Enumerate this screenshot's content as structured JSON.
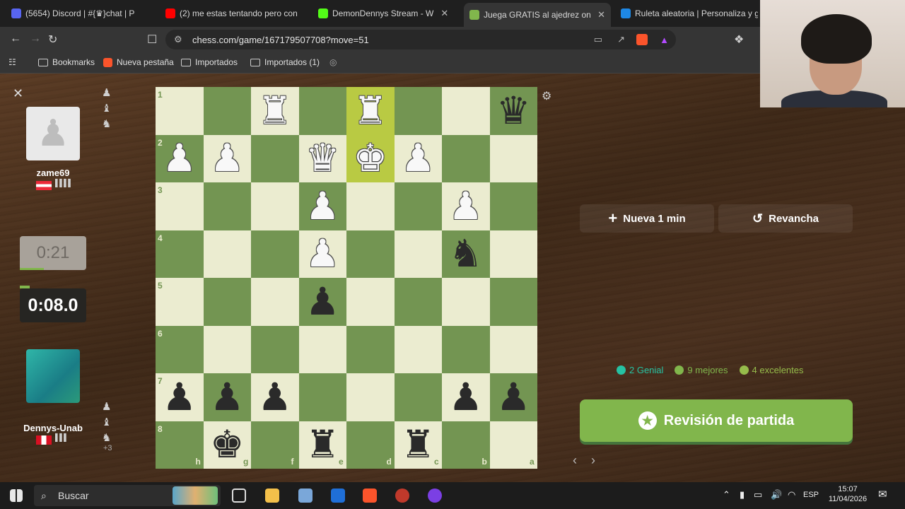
{
  "browser": {
    "tabs": [
      {
        "title": "(5654) Discord | #{♛}chat | P",
        "icon": "discord-icon",
        "color": "#5865f2",
        "active": false
      },
      {
        "title": "(2) me estas tentando pero con",
        "icon": "youtube-icon",
        "color": "#ff0000",
        "active": false
      },
      {
        "title": "DemonDennys Stream - W",
        "icon": "kick-icon",
        "color": "#53fc18",
        "active": false
      },
      {
        "title": "Juega GRATIS al ajedrez onlin",
        "icon": "chess-pawn-icon",
        "color": "#81b64c",
        "active": true
      },
      {
        "title": "Ruleta aleatoria | Personaliza y gir",
        "icon": "wheel-icon",
        "color": "#1e88e5",
        "active": false
      }
    ],
    "url": "chess.com/game/167179507708?move=51",
    "bookmarks": [
      "Bookmarks",
      "Nueva pestaña",
      "Importados",
      "Importados (1)"
    ]
  },
  "players": {
    "top": {
      "name": "zame69",
      "clock": "0:21"
    },
    "bottom": {
      "name": "Dennys-Unab",
      "clock": "0:08.0",
      "extra": "+3"
    }
  },
  "board": {
    "ranks": [
      "1",
      "2",
      "3",
      "4",
      "5",
      "6",
      "7",
      "8"
    ],
    "files": [
      "h",
      "g",
      "f",
      "e",
      "d",
      "c",
      "b",
      "a"
    ],
    "highlight": [
      [
        0,
        4
      ],
      [
        1,
        4
      ]
    ],
    "pieces": [
      {
        "r": 0,
        "c": 2,
        "p": "♜",
        "color": "white",
        "name": "white-rook"
      },
      {
        "r": 0,
        "c": 4,
        "p": "♜",
        "color": "white",
        "name": "white-rook"
      },
      {
        "r": 0,
        "c": 7,
        "p": "♛",
        "color": "black",
        "name": "black-queen"
      },
      {
        "r": 1,
        "c": 0,
        "p": "♟",
        "color": "white",
        "name": "white-pawn"
      },
      {
        "r": 1,
        "c": 1,
        "p": "♟",
        "color": "white",
        "name": "white-pawn"
      },
      {
        "r": 1,
        "c": 3,
        "p": "♛",
        "color": "white",
        "name": "white-queen"
      },
      {
        "r": 1,
        "c": 4,
        "p": "♚",
        "color": "white",
        "name": "white-king"
      },
      {
        "r": 1,
        "c": 5,
        "p": "♟",
        "color": "white",
        "name": "white-pawn"
      },
      {
        "r": 2,
        "c": 3,
        "p": "♟",
        "color": "white",
        "name": "white-pawn"
      },
      {
        "r": 2,
        "c": 6,
        "p": "♟",
        "color": "white",
        "name": "white-pawn"
      },
      {
        "r": 3,
        "c": 3,
        "p": "♟",
        "color": "white",
        "name": "white-pawn"
      },
      {
        "r": 3,
        "c": 6,
        "p": "♞",
        "color": "black",
        "name": "black-knight"
      },
      {
        "r": 4,
        "c": 3,
        "p": "♟",
        "color": "black",
        "name": "black-pawn"
      },
      {
        "r": 6,
        "c": 0,
        "p": "♟",
        "color": "black",
        "name": "black-pawn"
      },
      {
        "r": 6,
        "c": 1,
        "p": "♟",
        "color": "black",
        "name": "black-pawn"
      },
      {
        "r": 6,
        "c": 2,
        "p": "♟",
        "color": "black",
        "name": "black-pawn"
      },
      {
        "r": 6,
        "c": 6,
        "p": "♟",
        "color": "black",
        "name": "black-pawn"
      },
      {
        "r": 6,
        "c": 7,
        "p": "♟",
        "color": "black",
        "name": "black-pawn"
      },
      {
        "r": 7,
        "c": 1,
        "p": "♚",
        "color": "black",
        "name": "black-king"
      },
      {
        "r": 7,
        "c": 3,
        "p": "♜",
        "color": "black",
        "name": "black-rook"
      },
      {
        "r": 7,
        "c": 5,
        "p": "♜",
        "color": "black",
        "name": "black-rook"
      }
    ]
  },
  "actions": {
    "new_game": "Nueva 1 min",
    "rematch": "Revancha",
    "review": "Revisión de partida"
  },
  "stats": {
    "brilliant": "2 Genial",
    "best": "9 mejores",
    "excellent": "4 excelentes",
    "colors": {
      "brilliant": "#26c2a3",
      "best": "#81b64c",
      "excellent": "#96bc4b"
    }
  },
  "taskbar": {
    "search": "Buscar",
    "lang": "ESP",
    "time": "15:07",
    "date": "11/04/2026"
  }
}
